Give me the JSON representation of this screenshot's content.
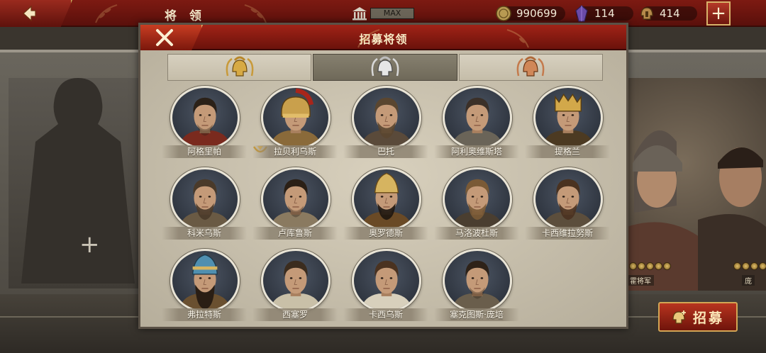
{
  "topbar": {
    "title": "将 领",
    "level_label": "MAX",
    "coins": "990699",
    "gems": "114",
    "helmets": "414",
    "plus_label": "+"
  },
  "modal": {
    "title": "招募将领",
    "tabs": [
      {
        "name": "gold-tier",
        "active": false
      },
      {
        "name": "silver-tier",
        "active": true
      },
      {
        "name": "bronze-tier",
        "active": false
      }
    ]
  },
  "generals": [
    {
      "name": "阿格里帕",
      "owned": false,
      "headgear": "none",
      "beard": "stubble",
      "hair": "#2b2118",
      "robe": "#7a2a1e"
    },
    {
      "name": "拉贝利乌斯",
      "owned": true,
      "headgear": "helmet",
      "beard": "none",
      "hair": "#3a2a1c",
      "robe": "#8a6a3a"
    },
    {
      "name": "巴托",
      "owned": false,
      "headgear": "none",
      "beard": "full",
      "hair": "#5a4630",
      "robe": "#5a4a3a"
    },
    {
      "name": "阿利奥维斯塔",
      "owned": false,
      "headgear": "none",
      "beard": "none",
      "hair": "#3b3028",
      "robe": "#6a6458"
    },
    {
      "name": "提格兰",
      "owned": false,
      "headgear": "crown",
      "beard": "none",
      "hair": "#2a1e16",
      "robe": "#4c3a22"
    },
    {
      "name": "科米乌斯",
      "owned": false,
      "headgear": "none",
      "beard": "full",
      "hair": "#4a3a2a",
      "robe": "#6a5a44"
    },
    {
      "name": "卢库鲁斯",
      "owned": false,
      "headgear": "none",
      "beard": "stubble",
      "hair": "#2b2016",
      "robe": "#8a7a60"
    },
    {
      "name": "奥罗德斯",
      "owned": false,
      "headgear": "tiara",
      "beard": "full",
      "hair": "#1e1610",
      "robe": "#6a4a26"
    },
    {
      "name": "马洛波杜斯",
      "owned": false,
      "headgear": "none",
      "beard": "full",
      "hair": "#7a5a36",
      "robe": "#4a3e30"
    },
    {
      "name": "卡西维拉努斯",
      "owned": false,
      "headgear": "none",
      "beard": "full",
      "hair": "#4a3220",
      "robe": "#5c4e3c"
    },
    {
      "name": "弗拉特斯",
      "owned": false,
      "headgear": "tiara-blue",
      "beard": "long",
      "hair": "#2a1e14",
      "robe": "#6a5030"
    },
    {
      "name": "西塞罗",
      "owned": false,
      "headgear": "none",
      "beard": "none",
      "hair": "#3b2c1e",
      "robe": "#c9c0a8"
    },
    {
      "name": "卡西乌斯",
      "owned": false,
      "headgear": "none",
      "beard": "none",
      "hair": "#4a3220",
      "robe": "#d8d0bc"
    },
    {
      "name": "塞克图斯·庞培",
      "owned": false,
      "headgear": "none",
      "beard": "stubble",
      "hair": "#2e2218",
      "robe": "#6a5e4c"
    }
  ],
  "background": {
    "right_name": "霍将军",
    "right_name_2": "庞",
    "recruit_label": "招募"
  },
  "colors": {
    "header_red": "#8a1c12",
    "gold_accent": "#d3a654",
    "panel_bg": "#d8d0bd"
  }
}
